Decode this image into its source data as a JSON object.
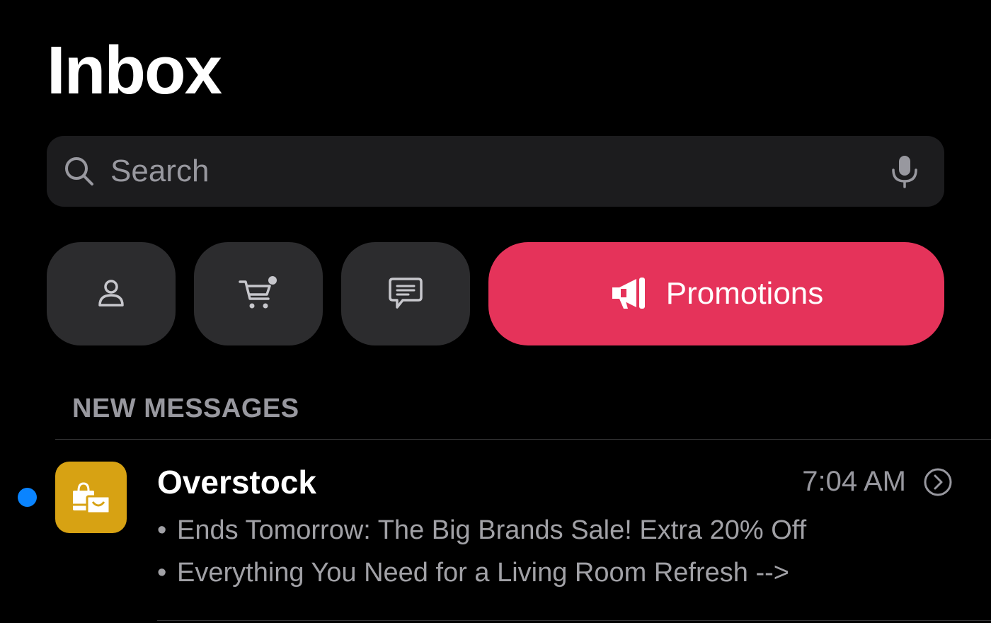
{
  "header": {
    "title": "Inbox"
  },
  "search": {
    "placeholder": "Search",
    "icon": "search-icon",
    "mic_icon": "microphone-icon"
  },
  "categories": [
    {
      "icon": "person-icon",
      "label": ""
    },
    {
      "icon": "cart-icon",
      "label": ""
    },
    {
      "icon": "chat-bubble-icon",
      "label": ""
    },
    {
      "icon": "megaphone-icon",
      "label": "Promotions",
      "selected": true
    }
  ],
  "colors": {
    "background": "#000000",
    "accent_promotions": "#e5335a",
    "unread_dot": "#0a84ff",
    "app_icon_bg": "#d7a213"
  },
  "section": {
    "title": "NEW MESSAGES"
  },
  "messages": [
    {
      "sender": "Overstock",
      "time": "7:04 AM",
      "unread": true,
      "app_icon": "shopping-bag-icon",
      "preview": [
        "Ends Tomorrow: The Big Brands Sale! Extra 20% Off",
        "Everything You Need for a Living Room Refresh -->"
      ],
      "bullet": "•"
    }
  ]
}
